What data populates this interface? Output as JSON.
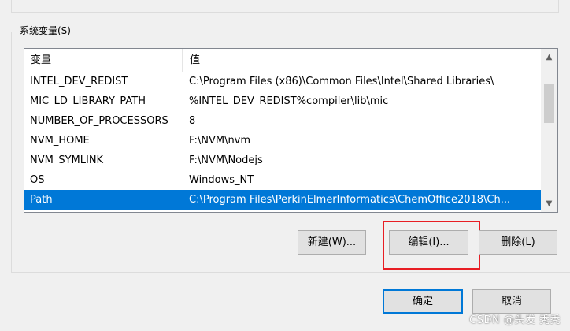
{
  "group_label": "系统变量(S)",
  "columns": {
    "name": "变量",
    "value": "值"
  },
  "variables": [
    {
      "name": "INTEL_DEV_REDIST",
      "value": "C:\\Program Files (x86)\\Common Files\\Intel\\Shared Libraries\\",
      "selected": false
    },
    {
      "name": "MIC_LD_LIBRARY_PATH",
      "value": "%INTEL_DEV_REDIST%compiler\\lib\\mic",
      "selected": false
    },
    {
      "name": "NUMBER_OF_PROCESSORS",
      "value": "8",
      "selected": false
    },
    {
      "name": "NVM_HOME",
      "value": "F:\\NVM\\nvm",
      "selected": false
    },
    {
      "name": "NVM_SYMLINK",
      "value": "F:\\NVM\\Nodejs",
      "selected": false
    },
    {
      "name": "OS",
      "value": "Windows_NT",
      "selected": false
    },
    {
      "name": "Path",
      "value": "C:\\Program Files\\PerkinElmerInformatics\\ChemOffice2018\\Ch...",
      "selected": true
    }
  ],
  "buttons": {
    "new": "新建(W)...",
    "edit": "编辑(I)...",
    "delete": "删除(L)",
    "ok": "确定",
    "cancel": "取消"
  },
  "scroll_icons": {
    "up": "▲",
    "down": "▼"
  },
  "watermark": "CSDN @头发 秃秃",
  "colors": {
    "selection": "#0078d7",
    "highlight": "#e81e24"
  }
}
